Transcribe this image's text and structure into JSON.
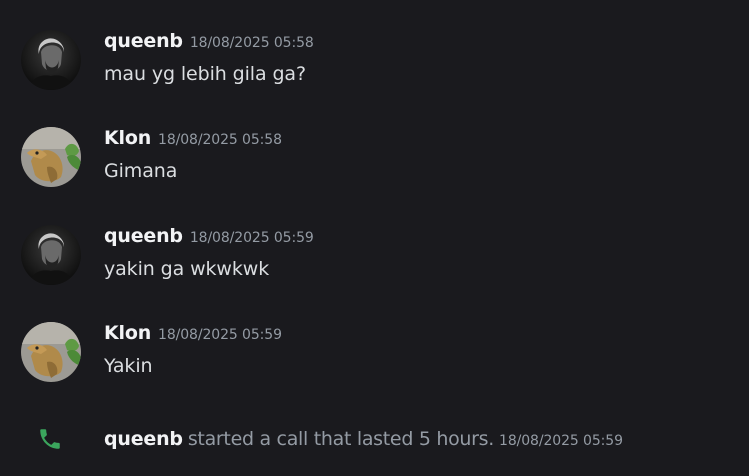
{
  "messages": [
    {
      "username": "queenb",
      "timestamp": "18/08/2025 05:58",
      "text": "mau yg lebih gila ga?",
      "avatar_icon": "dark-portrait-avatar"
    },
    {
      "username": "Klon",
      "timestamp": "18/08/2025 05:58",
      "text": "Gimana",
      "avatar_icon": "dinosaur-avatar"
    },
    {
      "username": "queenb",
      "timestamp": "18/08/2025 05:59",
      "text": "yakin ga wkwkwk",
      "avatar_icon": "dark-portrait-avatar"
    },
    {
      "username": "Klon",
      "timestamp": "18/08/2025 05:59",
      "text": "Yakin",
      "avatar_icon": "dinosaur-avatar"
    }
  ],
  "system_message": {
    "icon": "phone-icon",
    "username": "queenb",
    "text": "started a call that lasted 5 hours.",
    "timestamp": "18/08/2025 05:59"
  },
  "colors": {
    "background": "#1a1a1e",
    "username": "#f2f3f5",
    "message_text": "#dbdee1",
    "muted": "#949ba4",
    "call_green": "#3ba55d"
  }
}
